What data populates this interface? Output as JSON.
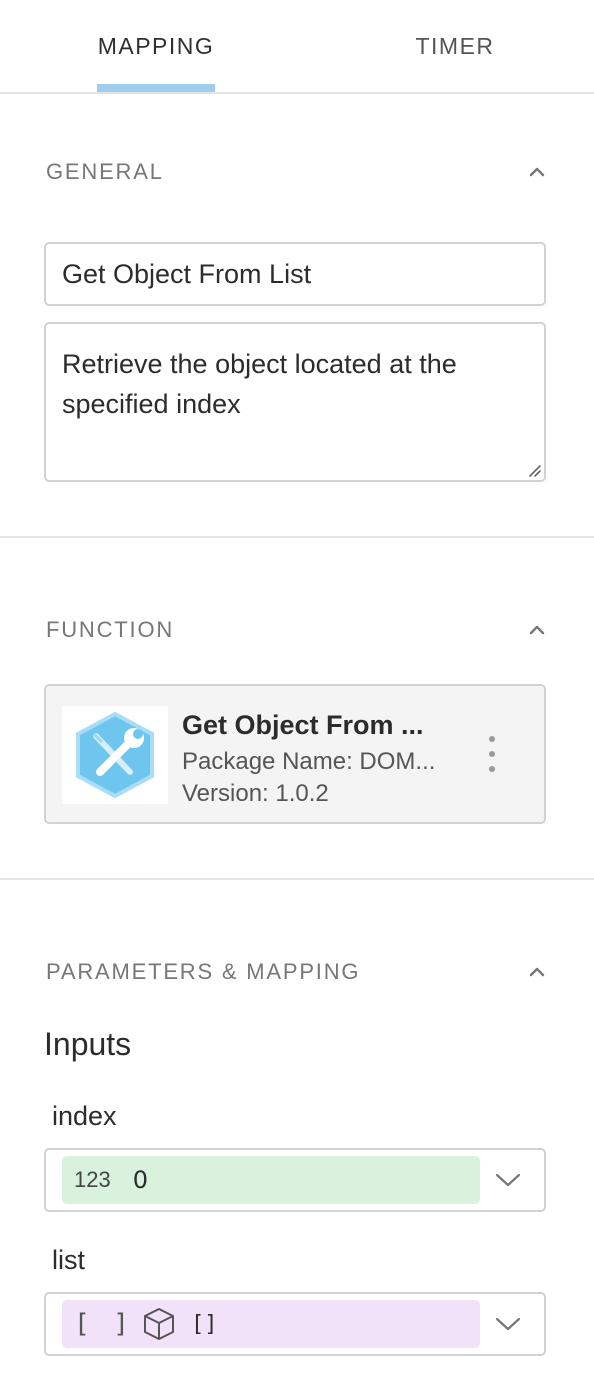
{
  "tabs": [
    {
      "label": "MAPPING",
      "active": true
    },
    {
      "label": "TIMER",
      "active": false
    }
  ],
  "general": {
    "title": "GENERAL",
    "name_value": "Get Object From List",
    "description_value": "Retrieve the object located at the specified index"
  },
  "function": {
    "title": "FUNCTION",
    "name": "Get Object From ...",
    "package": "Package Name: DOM...",
    "version": "Version: 1.0.2",
    "icon": "wrench-screwdriver-icon"
  },
  "parameters": {
    "title": "PARAMETERS & MAPPING",
    "inputs_heading": "Inputs",
    "items": [
      {
        "label": "index",
        "type_label": "123",
        "value": "0",
        "color": "#d8f2de"
      },
      {
        "label": "list",
        "type_label": "[ ]",
        "type_icon": "cube-icon",
        "value": "[]",
        "color": "#f1e2fa"
      }
    ]
  },
  "colors": {
    "accent_underline": "#9fcdee",
    "function_icon": "#6ec6ef"
  }
}
